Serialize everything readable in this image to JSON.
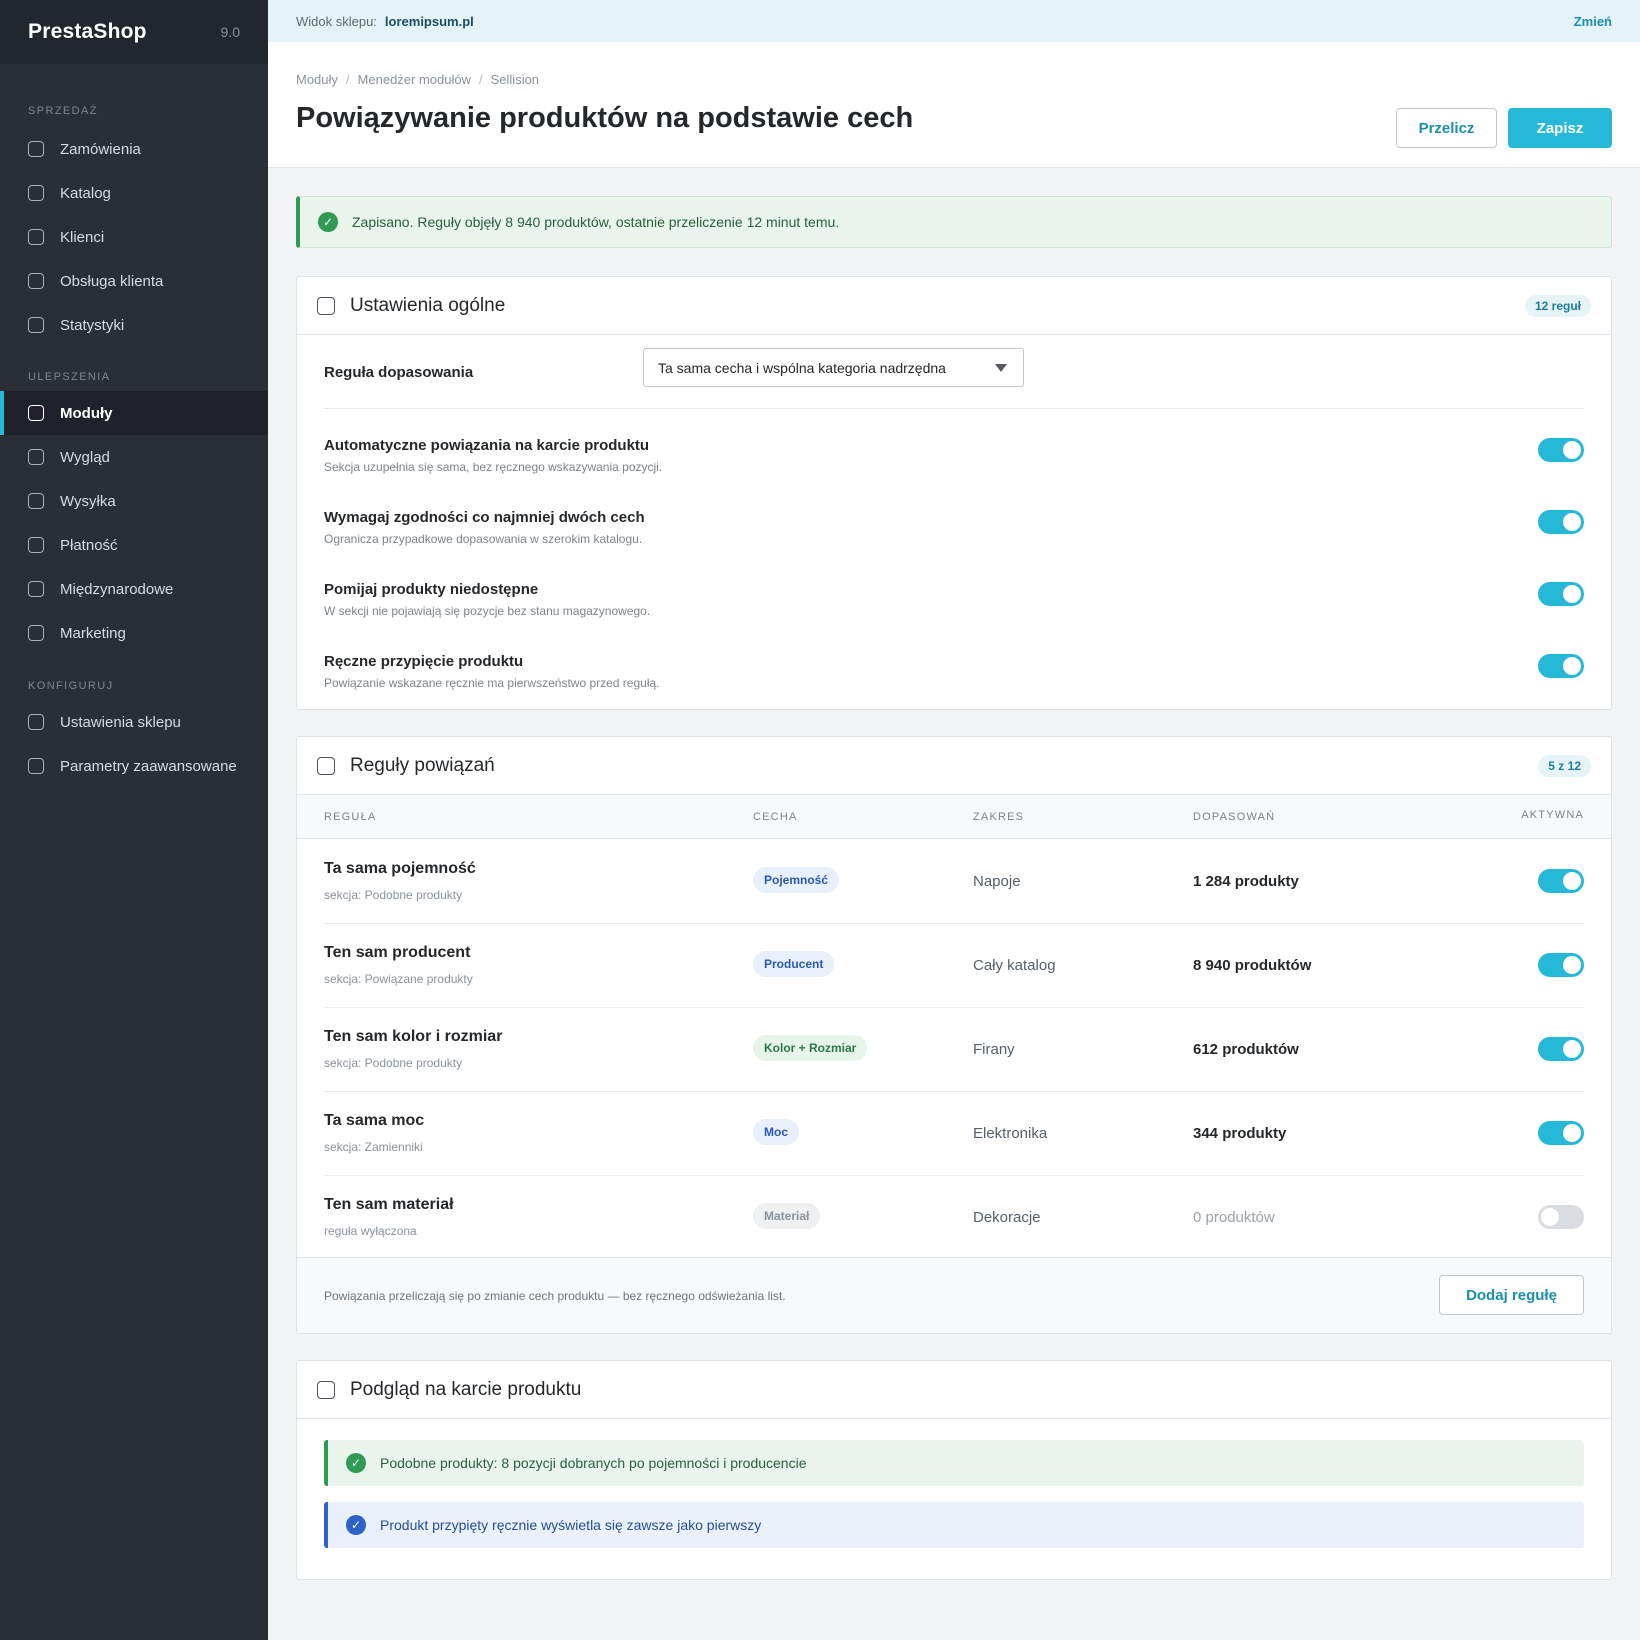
{
  "sidebar": {
    "brand": "PrestaShop",
    "version": "9.0",
    "sections": [
      {
        "heading": "SPRZEDAŻ",
        "items": [
          "Zamówienia",
          "Katalog",
          "Klienci",
          "Obsługa klienta",
          "Statystyki"
        ]
      },
      {
        "heading": "ULEPSZENIA",
        "items": [
          "Moduły",
          "Wygląd",
          "Wysyłka",
          "Płatność",
          "Międzynarodowe",
          "Marketing"
        ]
      },
      {
        "heading": "KONFIGURUJ",
        "items": [
          "Ustawienia sklepu",
          "Parametry zaawansowane"
        ]
      }
    ],
    "active_item": "Moduły"
  },
  "shopbar": {
    "label": "Widok sklepu:",
    "shop": "loremipsum.pl",
    "change": "Zmień"
  },
  "header": {
    "breadcrumb": [
      "Moduły",
      "Menedżer modułów",
      "Sellision"
    ],
    "title": "Powiązywanie produktów na podstawie cech",
    "recalc_label": "Przelicz",
    "save_label": "Zapisz"
  },
  "alert": {
    "text": "Zapisano. Reguły objęły 8 940 produktów, ostatnie przeliczenie 12 minut temu."
  },
  "general": {
    "title": "Ustawienia ogólne",
    "badge": "12 reguł",
    "match_rule_label": "Reguła dopasowania",
    "match_rule_value": "Ta sama cecha i wspólna kategoria nadrzędna",
    "options": [
      {
        "title": "Automatyczne powiązania na karcie produktu",
        "desc": "Sekcja uzupełnia się sama, bez ręcznego wskazywania pozycji.",
        "on": true
      },
      {
        "title": "Wymagaj zgodności co najmniej dwóch cech",
        "desc": "Ogranicza przypadkowe dopasowania w szerokim katalogu.",
        "on": true
      },
      {
        "title": "Pomijaj produkty niedostępne",
        "desc": "W sekcji nie pojawiają się pozycje bez stanu magazynowego.",
        "on": true
      },
      {
        "title": "Ręczne przypięcie produktu",
        "desc": "Powiązanie wskazane ręcznie ma pierwszeństwo przed regułą.",
        "on": true
      }
    ]
  },
  "rules": {
    "title": "Reguły powiązań",
    "badge": "5 z 12",
    "columns": [
      "REGUŁA",
      "CECHA",
      "ZAKRES",
      "DOPASOWAŃ",
      "AKTYWNA"
    ],
    "rows": [
      {
        "name": "Ta sama pojemność",
        "sub": "sekcja: Podobne produkty",
        "tag": "Pojemność",
        "tag_color": "blue",
        "scope": "Napoje",
        "count": "1 284 produkty",
        "active": true
      },
      {
        "name": "Ten sam producent",
        "sub": "sekcja: Powiązane produkty",
        "tag": "Producent",
        "tag_color": "blue",
        "scope": "Cały katalog",
        "count": "8 940 produktów",
        "active": true
      },
      {
        "name": "Ten sam kolor i rozmiar",
        "sub": "sekcja: Podobne produkty",
        "tag": "Kolor + Rozmiar",
        "tag_color": "green",
        "scope": "Firany",
        "count": "612 produktów",
        "active": true
      },
      {
        "name": "Ta sama moc",
        "sub": "sekcja: Zamienniki",
        "tag": "Moc",
        "tag_color": "blue",
        "scope": "Elektronika",
        "count": "344 produkty",
        "active": true
      },
      {
        "name": "Ten sam materiał",
        "sub": "reguła wyłączona",
        "tag": "Materiał",
        "tag_color": "gray",
        "scope": "Dekoracje",
        "count": "0 produktów",
        "active": false
      }
    ],
    "footer_note": "Powiązania przeliczają się po zmianie cech produktu — bez ręcznego odświeżania list.",
    "add_rule_label": "Dodaj regułę"
  },
  "preview": {
    "title": "Podgląd na karcie produktu",
    "success_text": "Podobne produkty: 8 pozycji dobranych po pojemności i producencie",
    "info_text": "Produkt przypięty ręcznie wyświetla się zawsze jako pierwszy"
  },
  "colors": {
    "accent": "#25b9d7",
    "sidebar": "#2a2f37",
    "success": "#2e9a53",
    "info": "#2f62c9"
  },
  "icons": {
    "nav": "checkbox-icon",
    "alert": "check-circle-icon",
    "select": "caret-down-icon"
  }
}
